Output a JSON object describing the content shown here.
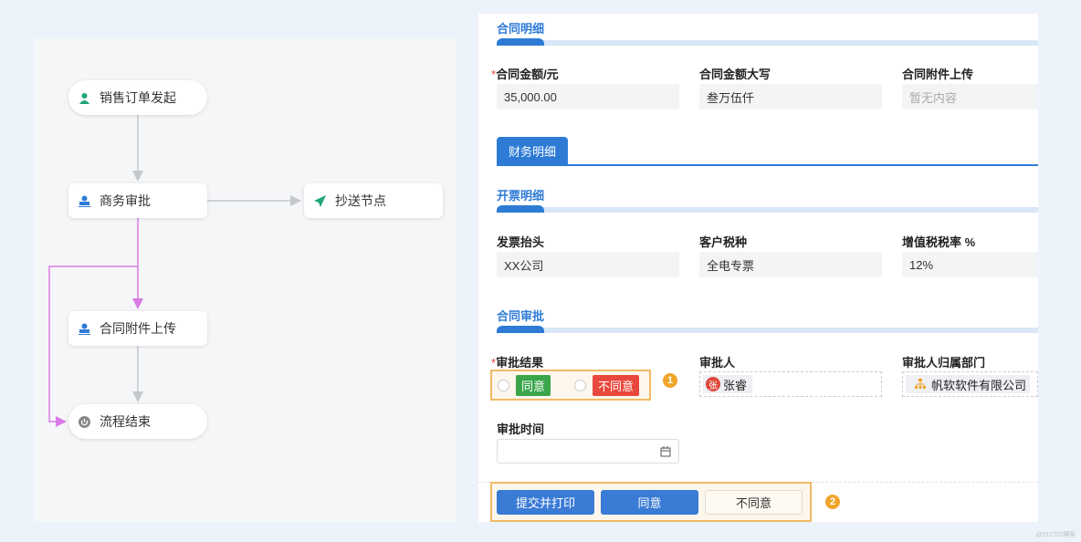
{
  "flow": {
    "nodes": [
      {
        "label": "销售订单发起",
        "icon": "user-icon"
      },
      {
        "label": "商务审批",
        "icon": "stamp-icon"
      },
      {
        "label": "抄送节点",
        "icon": "send-icon"
      },
      {
        "label": "合同附件上传",
        "icon": "stamp-icon"
      },
      {
        "label": "流程结束",
        "icon": "power-icon"
      }
    ]
  },
  "form": {
    "contract_section": "合同明细",
    "amount_label": "合同金额/元",
    "amount_value": "35,000.00",
    "amount_caps_label": "合同金额大写",
    "amount_caps_value": "叁万伍仟",
    "attachment_label": "合同附件上传",
    "attachment_placeholder": "暂无内容",
    "tab": "财务明细",
    "invoice_section": "开票明细",
    "invoice_title_label": "发票抬头",
    "invoice_title_value": "XX公司",
    "tax_type_label": "客户税种",
    "tax_type_value": "全电专票",
    "vat_label": "增值税税率 %",
    "vat_value": "12%",
    "approval_section": "合同审批",
    "result_label": "审批结果",
    "agree": "同意",
    "disagree": "不同意",
    "approver_label": "审批人",
    "approver_avatar": "张",
    "approver": "张睿",
    "dept_label": "审批人归属部门",
    "dept": "帆软软件有限公司",
    "time_label": "审批时间",
    "required_mark": "*"
  },
  "actions": {
    "submit_print": "提交并打印",
    "agree": "同意",
    "disagree": "不同意"
  },
  "annotations": {
    "one": "1",
    "two": "2"
  },
  "watermark": "@51CTO博客"
}
